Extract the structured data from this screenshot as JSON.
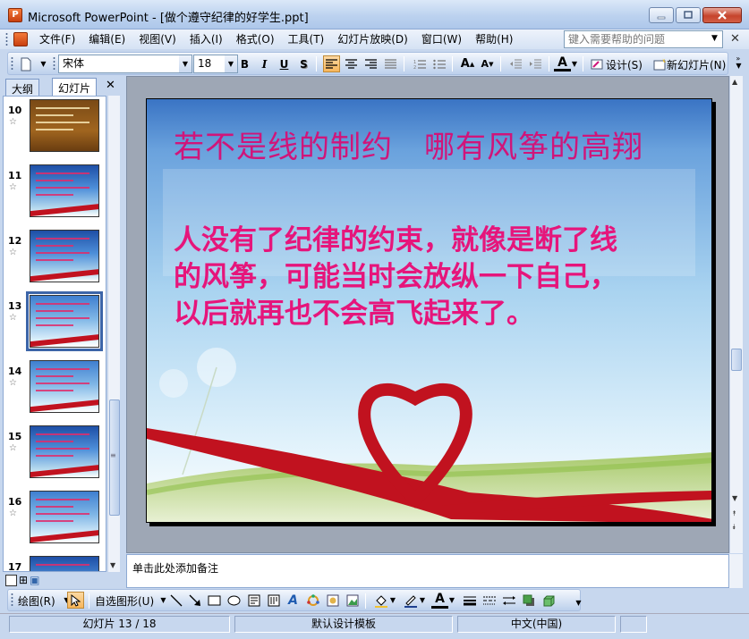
{
  "window": {
    "title": "Microsoft PowerPoint - [做个遵守纪律的好学生.ppt]"
  },
  "menu": {
    "items": [
      "文件(F)",
      "编辑(E)",
      "视图(V)",
      "插入(I)",
      "格式(O)",
      "工具(T)",
      "幻灯片放映(D)",
      "窗口(W)",
      "帮助(H)"
    ],
    "help_placeholder": "键入需要帮助的问题"
  },
  "toolbar": {
    "font_name": "宋体",
    "font_size": "18",
    "bold_label": "B",
    "italic_label": "I",
    "underline_label": "U",
    "shadow_label": "S",
    "design_label": "设计(S)",
    "new_slide_label": "新幻灯片(N)"
  },
  "outline_panel": {
    "tabs": [
      "大纲",
      "幻灯片"
    ],
    "active_tab": "幻灯片",
    "slides": [
      {
        "number": "10",
        "style": "brown"
      },
      {
        "number": "11",
        "style": "blue"
      },
      {
        "number": "12",
        "style": "blue"
      },
      {
        "number": "13",
        "style": "sky",
        "selected": true
      },
      {
        "number": "14",
        "style": "sky"
      },
      {
        "number": "15",
        "style": "blue"
      },
      {
        "number": "16",
        "style": "sky"
      },
      {
        "number": "17",
        "style": "blue"
      }
    ]
  },
  "slide": {
    "title": "若不是线的制约　哪有风筝的高翔",
    "body_lines": [
      "人没有了纪律的约束，就像是断了线",
      "的风筝，可能当时会放纵一下自己，",
      "以后就再也不会高飞起来了。"
    ]
  },
  "notes": {
    "placeholder": "单击此处添加备注"
  },
  "drawing_toolbar": {
    "draw_label": "绘图(R)",
    "autoshapes_label": "自选图形(U)"
  },
  "statusbar": {
    "slide_position": "幻灯片 13 / 18",
    "design_template": "默认设计模板",
    "language": "中文(中国)"
  },
  "colors": {
    "slide_title": "#d0157a",
    "slide_body": "#e6157b",
    "selection": "#3c65a8"
  }
}
